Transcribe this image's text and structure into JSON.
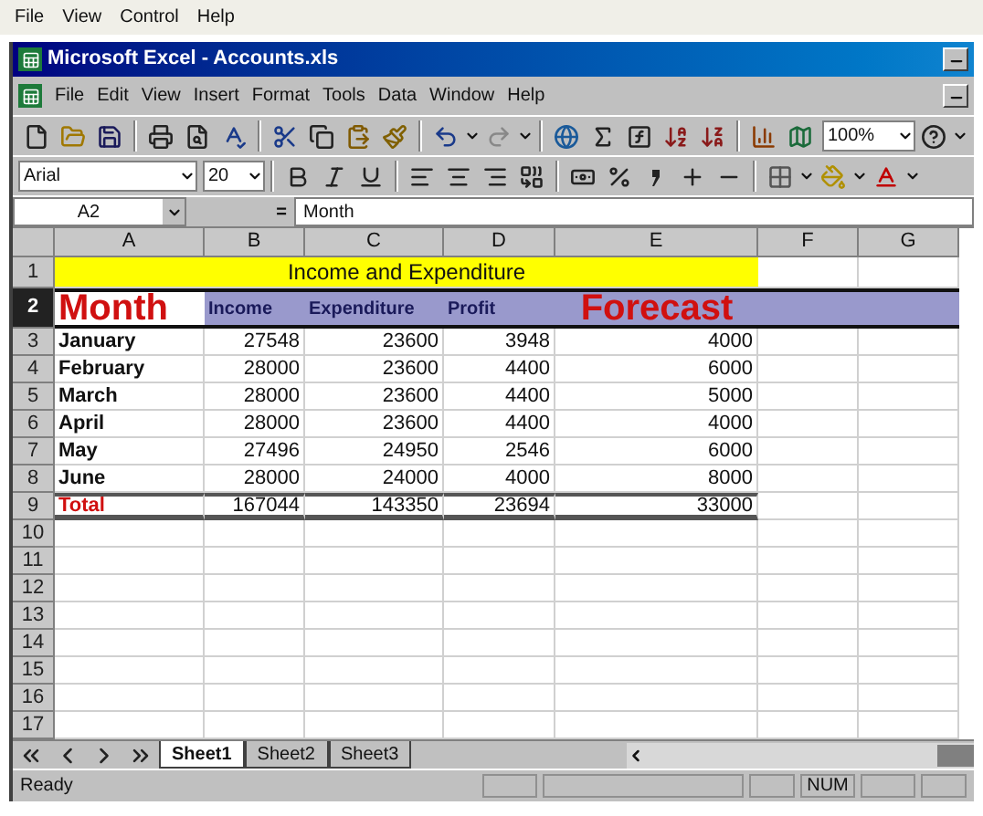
{
  "host_menu": [
    "File",
    "View",
    "Control",
    "Help"
  ],
  "window": {
    "title": "Microsoft Excel - Accounts.xls"
  },
  "menu": [
    "File",
    "Edit",
    "View",
    "Insert",
    "Format",
    "Tools",
    "Data",
    "Window",
    "Help"
  ],
  "toolbar": {
    "zoom": "100%"
  },
  "format_toolbar": {
    "font": "Arial",
    "size": "20"
  },
  "formula_bar": {
    "name_box": "A2",
    "equals": "=",
    "value": "Month"
  },
  "sheet": {
    "columns": [
      "A",
      "B",
      "C",
      "D",
      "E",
      "F",
      "G"
    ],
    "title_row": {
      "row": "1",
      "text": "Income and Expenditure"
    },
    "header_row": {
      "row": "2",
      "selected": true,
      "cells": [
        {
          "text": "Month",
          "kind": "large"
        },
        {
          "text": "Income",
          "kind": "label"
        },
        {
          "text": "Expenditure",
          "kind": "label"
        },
        {
          "text": "Profit",
          "kind": "label"
        },
        {
          "text": "Forecast",
          "kind": "large"
        }
      ]
    },
    "data_rows": [
      {
        "row": "3",
        "selected": false,
        "cells": [
          "January",
          "27548",
          "23600",
          "3948",
          "4000"
        ]
      },
      {
        "row": "4",
        "selected": false,
        "cells": [
          "February",
          "28000",
          "23600",
          "4400",
          "6000"
        ]
      },
      {
        "row": "5",
        "selected": false,
        "cells": [
          "March",
          "28000",
          "23600",
          "4400",
          "5000"
        ]
      },
      {
        "row": "6",
        "selected": false,
        "cells": [
          "April",
          "28000",
          "23600",
          "4400",
          "4000"
        ]
      },
      {
        "row": "7",
        "selected": false,
        "cells": [
          "May",
          "27496",
          "24950",
          "2546",
          "6000"
        ]
      },
      {
        "row": "8",
        "selected": false,
        "cells": [
          "June",
          "28000",
          "24000",
          "4000",
          "8000"
        ]
      }
    ],
    "total_row": {
      "row": "9",
      "selected": false,
      "cells": [
        "Total",
        "167044",
        "143350",
        "23694",
        "33000"
      ]
    },
    "empty_rows": [
      "10",
      "11",
      "12",
      "13",
      "14",
      "15",
      "16",
      "17"
    ]
  },
  "sheet_tabs": [
    {
      "label": "Sheet1",
      "selected": true
    },
    {
      "label": "Sheet2",
      "selected": false
    },
    {
      "label": "Sheet3",
      "selected": false
    }
  ],
  "status_bar": {
    "text": "Ready",
    "num": "NUM"
  }
}
